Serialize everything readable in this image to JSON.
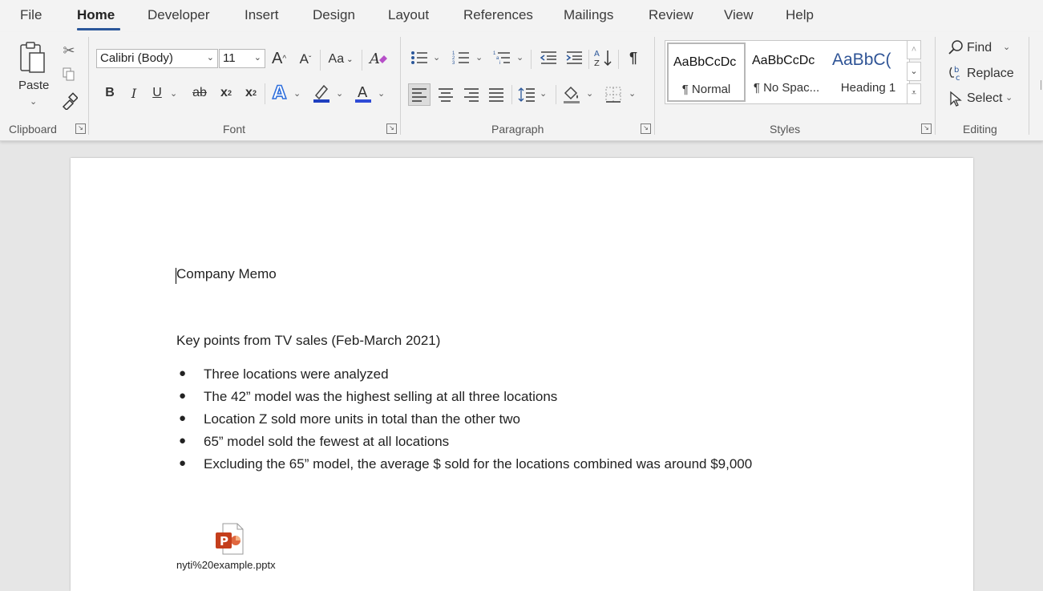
{
  "tabs": [
    {
      "label": "File"
    },
    {
      "label": "Home"
    },
    {
      "label": "Developer"
    },
    {
      "label": "Insert"
    },
    {
      "label": "Design"
    },
    {
      "label": "Layout"
    },
    {
      "label": "References"
    },
    {
      "label": "Mailings"
    },
    {
      "label": "Review"
    },
    {
      "label": "View"
    },
    {
      "label": "Help"
    }
  ],
  "active_tab": "Home",
  "ribbon": {
    "clipboard": {
      "label": "Clipboard",
      "paste_label": "Paste"
    },
    "font": {
      "label": "Font",
      "font_name": "Calibri (Body)",
      "font_size": "11",
      "grow_glyph": "A",
      "change_case_label": "Aa",
      "bold": "B",
      "italic": "I",
      "underline": "U",
      "strike": "ab",
      "subscript": "x",
      "sub_small": "2",
      "superscript": "x",
      "sup_small": "2"
    },
    "paragraph": {
      "label": "Paragraph"
    },
    "styles": {
      "label": "Styles",
      "items": [
        {
          "sample": "AaBbCcDc",
          "name": "¶ Normal"
        },
        {
          "sample": "AaBbCcDc",
          "name": "¶ No Spac..."
        },
        {
          "sample": "AaBbC(",
          "name": "Heading 1"
        }
      ],
      "heading_color": "#2f5496"
    },
    "editing": {
      "label": "Editing",
      "find": "Find",
      "replace": "Replace",
      "select": "Select"
    }
  },
  "document": {
    "title": "Company Memo",
    "subtitle": "Key points from TV sales (Feb-March 2021)",
    "bullets": [
      "Three locations were analyzed",
      "The 42” model was the highest selling at all three locations",
      "Location Z sold more units in total than the other two",
      "65” model sold the fewest at all locations",
      "Excluding the 65” model, the average $ sold for the locations combined was around $9,000"
    ],
    "attachment": {
      "filename": "nyti%20example.pptx",
      "icon_letter": "P"
    }
  },
  "colors": {
    "accent": "#2b579a",
    "ppt_orange": "#c43e1c",
    "font_color_bar": "#2f4bd6",
    "highlight_bar": "#1f3fbf"
  }
}
